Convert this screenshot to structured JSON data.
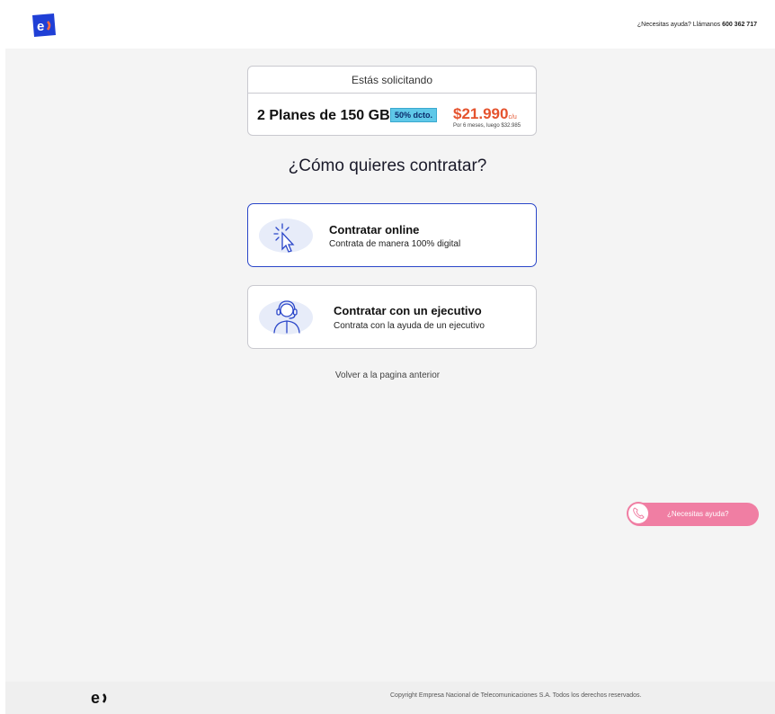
{
  "header": {
    "help_prefix": "¿Necesitas ayuda? Llámanos",
    "help_phone": "600 362 717"
  },
  "summary": {
    "heading": "Estás solicitando",
    "plan": "2 Planes de 150 GB",
    "discount": "50% dcto.",
    "price": "$21.990",
    "price_unit": "c/u",
    "price_note": "Por 6 meses, luego $32.985"
  },
  "question": "¿Cómo quieres contratar?",
  "options": [
    {
      "title": "Contratar online",
      "subtitle": "Contrata de manera 100% digital",
      "icon": "cursor-click-icon"
    },
    {
      "title": "Contratar con un ejecutivo",
      "subtitle": "Contrata con la ayuda de un ejecutivo",
      "icon": "headset-agent-icon"
    }
  ],
  "back_link": "Volver a la pagina anterior",
  "help_button": {
    "label": "¿Necesitas ayuda?",
    "icon": "phone-icon"
  },
  "footer": {
    "copyright": "Copyright Empresa Nacional de Telecomunicaciones S.A. Todos los derechos reservados."
  },
  "colors": {
    "brand_blue": "#2a46c9",
    "price_orange": "#e5532e",
    "discount_cyan": "#5fc8e8",
    "help_pink": "#f07ea3"
  }
}
